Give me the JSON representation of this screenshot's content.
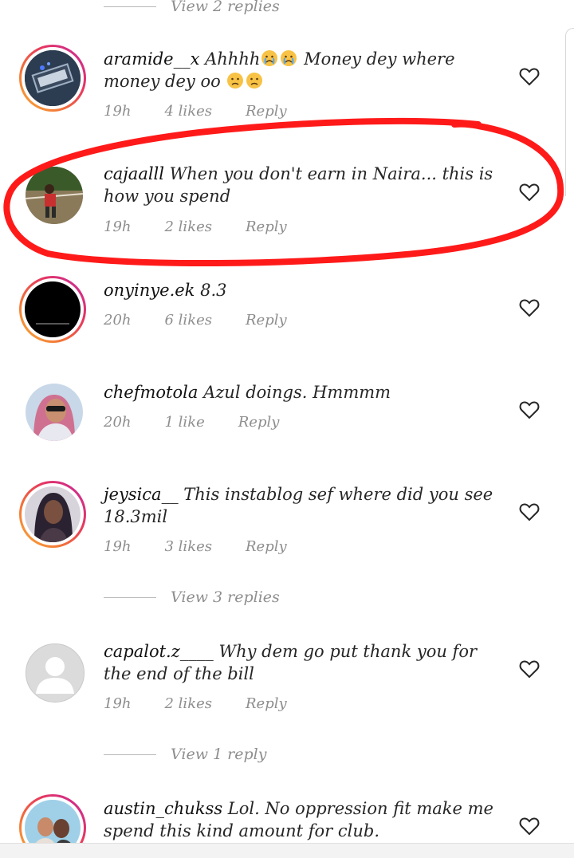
{
  "view_replies_top": "View 2 replies",
  "comments": [
    {
      "username": "aramide__x",
      "text_a": "Ahhhh",
      "text_b": "Money dey where money dey oo",
      "time": "19h",
      "likes": "4 likes",
      "reply": "Reply"
    },
    {
      "username": "cajaalll",
      "text": "When you don't earn in Naira... this is how you spend",
      "time": "19h",
      "likes": "2 likes",
      "reply": "Reply"
    },
    {
      "username": "onyinye.ek",
      "text": "8.3",
      "time": "20h",
      "likes": "6 likes",
      "reply": "Reply"
    },
    {
      "username": "chefmotola",
      "text": "Azul doings. Hmmmm",
      "time": "20h",
      "likes": "1 like",
      "reply": "Reply"
    },
    {
      "username": "jeysica__",
      "text": "This instablog sef where did you see 18.3mil",
      "time": "19h",
      "likes": "3 likes",
      "reply": "Reply"
    },
    {
      "username": "capalot.z____",
      "text": "Why dem go put thank you for the end of the bill",
      "time": "19h",
      "likes": "2 likes",
      "reply": "Reply"
    },
    {
      "username": "austin_chukss",
      "text": "Lol. No oppression fit make me spend this kind amount for club."
    }
  ],
  "view_replies_mid": "View 3 replies",
  "view_replies_low": "View 1 reply",
  "colors": {
    "annotation": "#ff1a1a",
    "meta": "#8e8e8e",
    "text": "#262626"
  }
}
